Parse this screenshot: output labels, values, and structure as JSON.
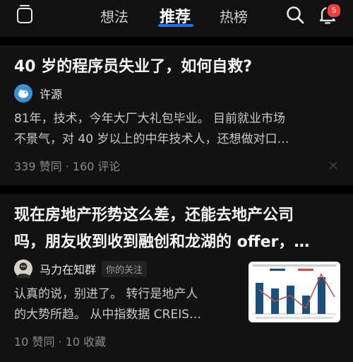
{
  "header": {
    "tabs": [
      {
        "label": "想法"
      },
      {
        "label": "推荐"
      },
      {
        "label": "热榜"
      }
    ],
    "notification_count": "5"
  },
  "feed": [
    {
      "title": "40 岁的程序员失业了，如何自救?",
      "author": "许源",
      "excerpt_line1": "81年，技术，今年大厂大礼包毕业。 目前就业市场",
      "excerpt_line2": "不景气，对 40 岁以上的中年技术人，还想做对口…",
      "meta": "339 赞同 · 160 评论"
    },
    {
      "title_line1": "现在房地产形势这么差，还能去地产公司",
      "title_line2": "吗，朋友收到收到融创和龙湖的 offer，…",
      "author": "马力在知群",
      "follow_tag": "你的关注",
      "excerpt_line1": "认真的说，别进了。 转行是地产人",
      "excerpt_line2": "的大势所趋。 从中指数据 CREIS…",
      "meta": "10 赞同 · 10 收藏"
    }
  ],
  "colors": {
    "accent": "#1772f6",
    "badge": "#f1403c",
    "background": "#0a0a0a",
    "card": "#121212"
  }
}
